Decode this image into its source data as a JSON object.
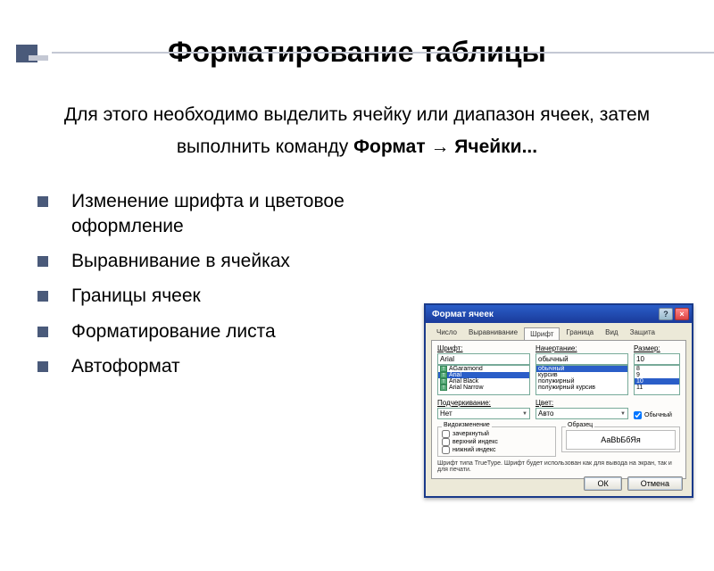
{
  "title": "Форматирование таблицы",
  "intro": {
    "part1": "Для этого необходимо выделить ячейку или диапазон ячеек, затем выполнить команду ",
    "bold": "Формат → Ячейки..."
  },
  "bullets": [
    "Изменение шрифта и цветовое оформление",
    "Выравнивание в ячейках",
    "Границы ячеек",
    "Форматирование листа",
    "Автоформат"
  ],
  "dialog": {
    "title": "Формат ячеек",
    "tabs": [
      "Число",
      "Выравнивание",
      "Шрифт",
      "Граница",
      "Вид",
      "Защита"
    ],
    "activeTab": "Шрифт",
    "font": {
      "label": "Шрифт:",
      "value": "Arial",
      "options": [
        "AGaramond",
        "Arial",
        "Arial Black",
        "Arial Narrow"
      ]
    },
    "style": {
      "label": "Начертание:",
      "value": "обычный",
      "options": [
        "обычный",
        "курсив",
        "полужирный",
        "полужирный курсив"
      ]
    },
    "size": {
      "label": "Размер:",
      "value": "10",
      "options": [
        "8",
        "9",
        "10",
        "11"
      ]
    },
    "underline": {
      "label": "Подчеркивание:",
      "value": "Нет"
    },
    "color": {
      "label": "Цвет:",
      "value": "Авто"
    },
    "normalFont": {
      "label": "Обычный",
      "checked": true
    },
    "effects": {
      "group": "Видоизменение",
      "strike": "зачеркнутый",
      "super": "верхний индекс",
      "sub": "нижний индекс"
    },
    "sample": {
      "group": "Образец",
      "text": "АаВbБбЯя"
    },
    "footnote": "Шрифт типа TrueType. Шрифт будет использован как для вывода на экран, так и для печати.",
    "ok": "ОК",
    "cancel": "Отмена"
  }
}
